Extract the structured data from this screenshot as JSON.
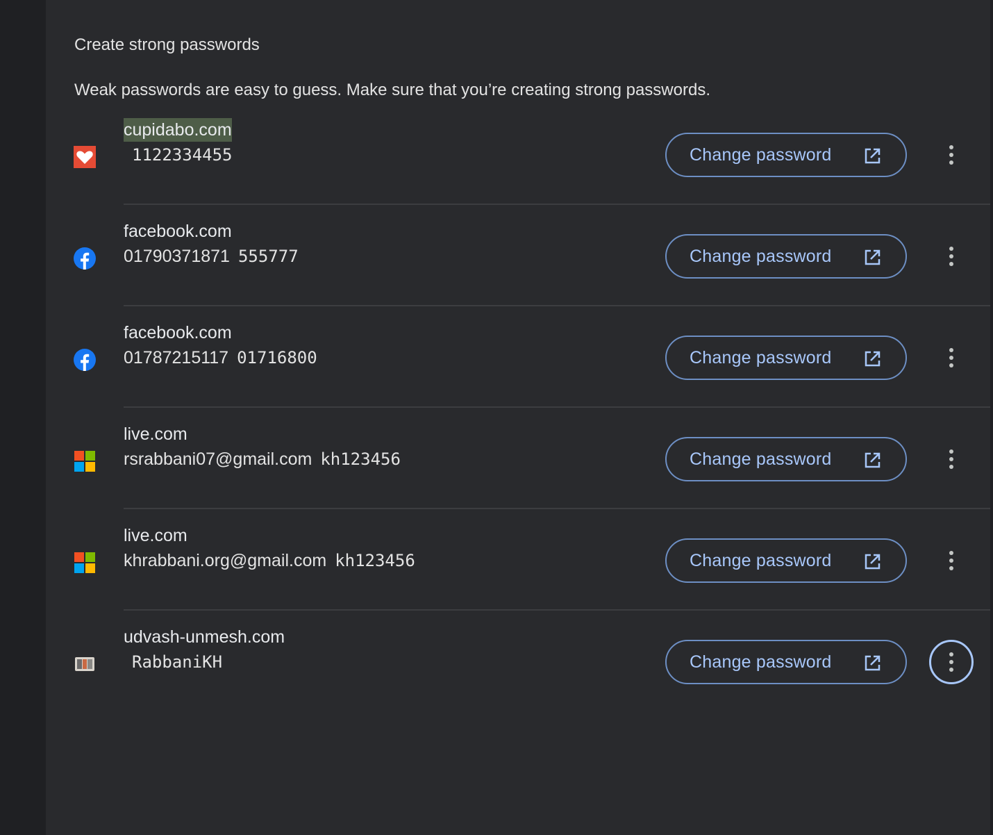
{
  "section": {
    "title": "Create strong passwords",
    "description": "Weak passwords are easy to guess. Make sure that you’re creating strong passwords."
  },
  "accent_color": "#a8c7fa",
  "rows": [
    {
      "site": "cupidabo.com",
      "username": "",
      "password": "1122334455",
      "icon": "heart-icon",
      "button_label": "Change password"
    },
    {
      "site": "facebook.com",
      "username": "01790371871",
      "password": "555777",
      "icon": "facebook-icon",
      "button_label": "Change password"
    },
    {
      "site": "facebook.com",
      "username": "01787215117",
      "password": "01716800",
      "icon": "facebook-icon",
      "button_label": "Change password"
    },
    {
      "site": "live.com",
      "username": "rsrabbani07@gmail.com",
      "password": "kh123456",
      "icon": "microsoft-icon",
      "button_label": "Change password"
    },
    {
      "site": "live.com",
      "username": "khrabbani.org@gmail.com",
      "password": "kh123456",
      "icon": "microsoft-icon",
      "button_label": "Change password"
    },
    {
      "site": "udvash-unmesh.com",
      "username": "",
      "password": "RabbaniKH",
      "icon": "udvash-icon",
      "button_label": "Change password"
    }
  ]
}
